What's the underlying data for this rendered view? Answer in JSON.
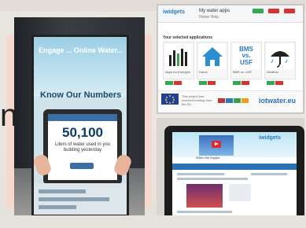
{
  "left_photo": {
    "kiosk_title": "Engage ... Online Water...",
    "kiosk_subtitle": "Know Our Numbers",
    "tablet_header": "iwidgets",
    "tablet_number": "50,100",
    "tablet_caption": "Liters of water used in you building yesterday"
  },
  "slide": {
    "partial_letter": "n"
  },
  "desktop_app": {
    "logo": "iwidgets",
    "app_title": "My water apps",
    "menu": "Home   Help",
    "section_title": "Your selected applications",
    "cards": [
      {
        "label": "Apps for Energies",
        "tile": "bar-chart"
      },
      {
        "label": "Home",
        "tile": "house"
      },
      {
        "label": "BMS vs. USF",
        "tile": "text"
      },
      {
        "label": "Weather",
        "tile": "umbrella"
      }
    ],
    "card_text_tile": "BMS\nvs.\nUSF",
    "footer_text": "This project has received funding from the EU",
    "brand": "iotwater.eu"
  },
  "tablet_app": {
    "video_caption": "When the hoppin...",
    "logo": "iwidgets",
    "bar_label": "Enter your Sensor Data"
  },
  "colors": {
    "accent_blue": "#2a7bbd",
    "panel_pink": "#f6d9cc",
    "tag_green": "#33a852",
    "tag_red": "#d9322f"
  }
}
